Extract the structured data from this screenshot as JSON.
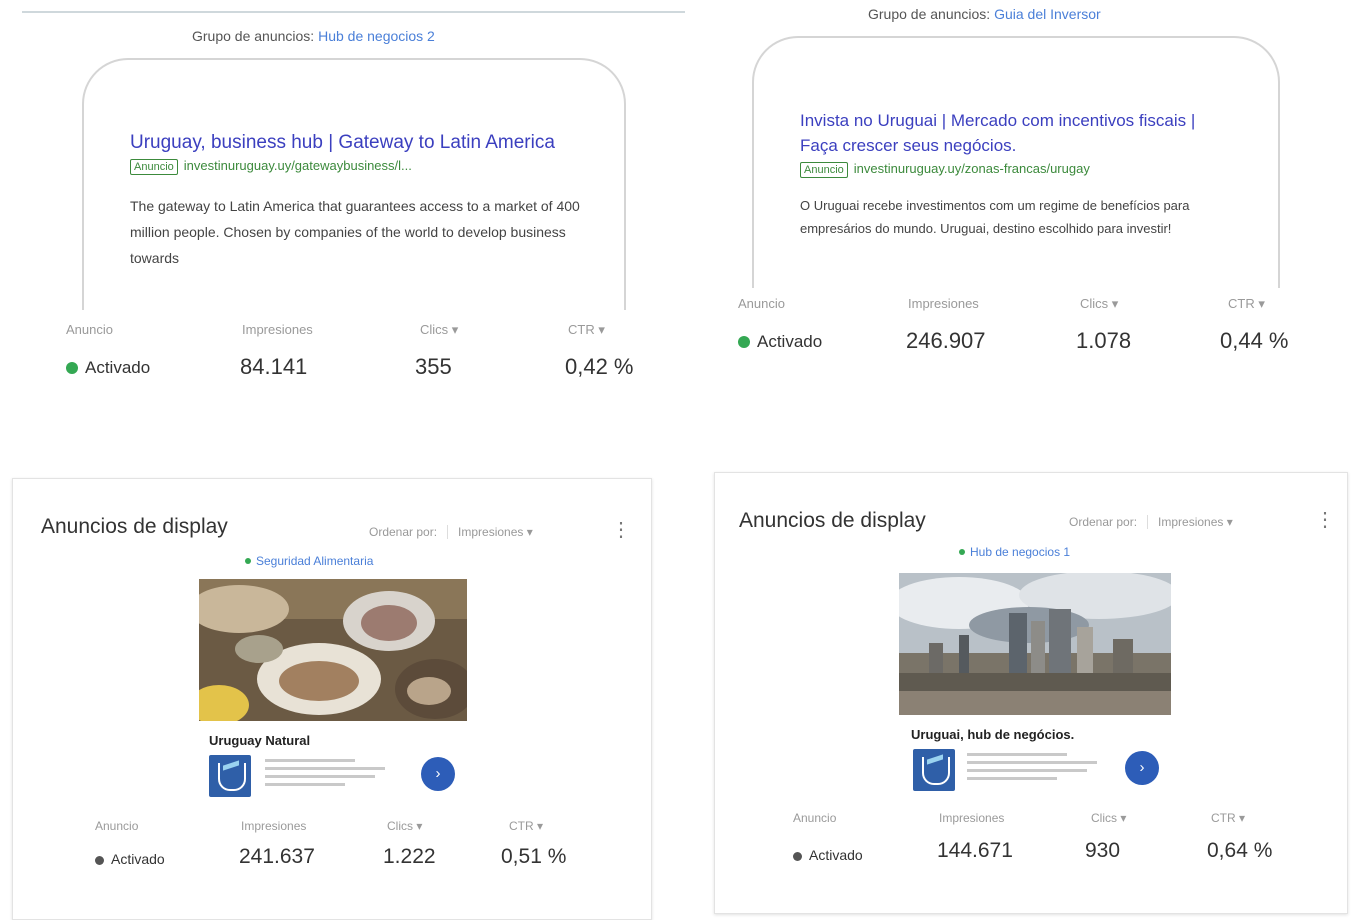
{
  "search_ads": [
    {
      "ad_group_label": "Grupo de anuncios:",
      "ad_group_name": "Hub de negocios 2",
      "headline": "Uruguay, business hub | Gateway to Latin America",
      "badge": "Anuncio",
      "url": "investinuruguay.uy/gatewaybusiness/l...",
      "description": "The gateway to Latin America that guarantees access to a market of 400 million people. Chosen by companies of the world to develop business towards",
      "headers": {
        "anuncio": "Anuncio",
        "impressions": "Impresiones",
        "clicks": "Clics",
        "ctr": "CTR"
      },
      "status": "Activado",
      "impressions": "84.141",
      "clicks": "355",
      "ctr": "0,42 %"
    },
    {
      "ad_group_label": "Grupo de anuncios:",
      "ad_group_name": "Guia del Inversor",
      "headline": "Invista no Uruguai | Mercado com incentivos fiscais | Faça crescer seus negócios.",
      "badge": "Anuncio",
      "url": "investinuruguay.uy/zonas-francas/urugay",
      "description": "O Uruguai recebe investimentos com um regime de benefícios para empresários do mundo. Uruguai, destino escolhido para investir!",
      "headers": {
        "anuncio": "Anuncio",
        "impressions": "Impresiones",
        "clicks": "Clics",
        "ctr": "CTR"
      },
      "status": "Activado",
      "impressions": "246.907",
      "clicks": "1.078",
      "ctr": "0,44 %"
    }
  ],
  "display_ads": [
    {
      "title": "Anuncios de display",
      "sort_label": "Ordenar por:",
      "sort_value": "Impresiones",
      "ad_group": "Seguridad Alimentaria",
      "brand": "Uruguay Natural",
      "headers": {
        "anuncio": "Anuncio",
        "impressions": "Impresiones",
        "clicks": "Clics",
        "ctr": "CTR"
      },
      "status": "Activado",
      "impressions": "241.637",
      "clicks": "1.222",
      "ctr": "0,51 %"
    },
    {
      "title": "Anuncios de display",
      "sort_label": "Ordenar por:",
      "sort_value": "Impresiones",
      "ad_group": "Hub de negocios 1",
      "brand": "Uruguai, hub de negócios.",
      "headers": {
        "anuncio": "Anuncio",
        "impressions": "Impresiones",
        "clicks": "Clics",
        "ctr": "CTR"
      },
      "status": "Activado",
      "impressions": "144.671",
      "clicks": "930",
      "ctr": "0,64 %"
    }
  ],
  "icons": {
    "sort_caret": "▾",
    "kebab": "⋮",
    "arrow": "›"
  },
  "colors": {
    "status_green": "#34a853",
    "headline_blue": "#3b3fbf",
    "url_green": "#3c8a3c",
    "link_blue": "#4a7fd8"
  }
}
